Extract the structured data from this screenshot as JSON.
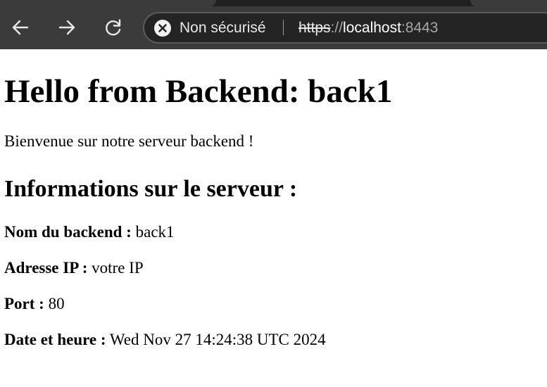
{
  "browser": {
    "security_label": "Non sécurisé",
    "url": {
      "scheme": "https",
      "separator": "://",
      "host": "localhost",
      "port": ":8443"
    },
    "icons": {
      "back": "arrow-left-icon",
      "forward": "arrow-right-icon",
      "reload": "reload-icon",
      "security": "not-secure-icon"
    },
    "colors": {
      "toolbar": "#3b3b3b",
      "omnibox": "#242424",
      "tab_accent": "#e0833c"
    }
  },
  "page": {
    "heading": "Hello from Backend: back1",
    "intro": "Bienvenue sur notre serveur backend !",
    "section_title": "Informations sur le serveur :",
    "info": [
      {
        "label": "Nom du backend :",
        "value": "back1"
      },
      {
        "label": "Adresse IP :",
        "value": "votre IP"
      },
      {
        "label": "Port :",
        "value": "80"
      },
      {
        "label": "Date et heure :",
        "value": "Wed Nov 27 14:24:38 UTC 2024"
      }
    ]
  }
}
